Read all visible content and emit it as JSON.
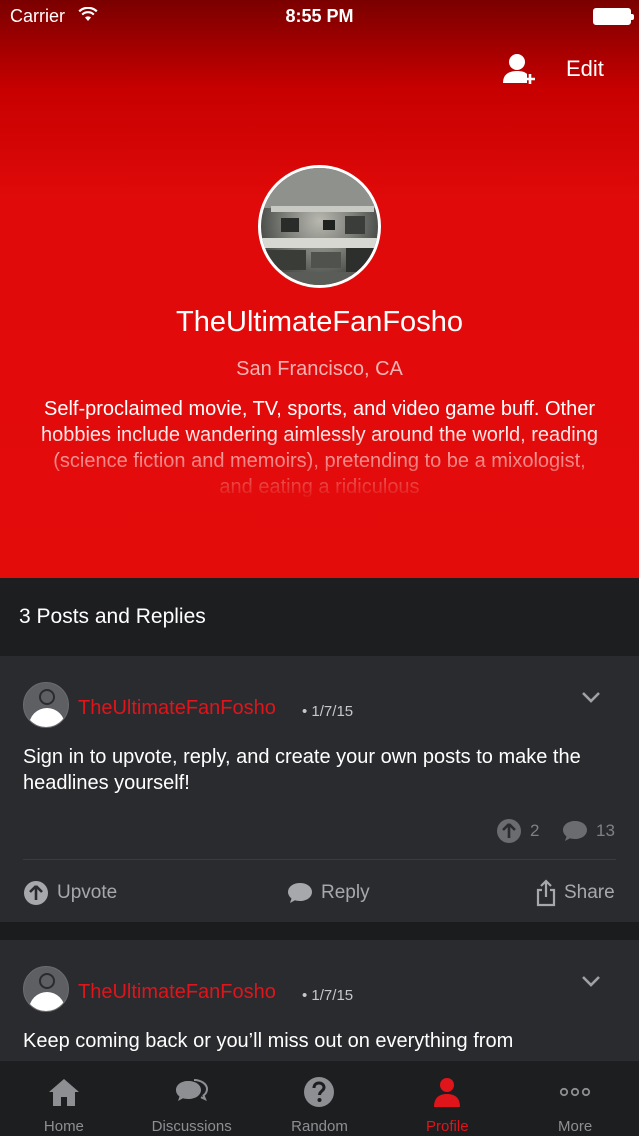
{
  "status_bar": {
    "carrier": "Carrier",
    "time": "8:55 PM"
  },
  "header": {
    "edit_label": "Edit",
    "username": "TheUltimateFanFosho",
    "location": "San Francisco, CA",
    "bio": "Self-proclaimed movie, TV, sports, and video game buff. Other hobbies include wandering aimlessly around the world, reading (science fiction and memoirs), pretending to be a mixologist, and eating a ridiculous"
  },
  "section": {
    "title": "3 Posts and Replies"
  },
  "posts": [
    {
      "author": "TheUltimateFanFosho",
      "date": "• 1/7/15",
      "text": "Sign in to upvote, reply, and create your own posts to make the headlines yourself!",
      "upvotes": "2",
      "comments": "13",
      "upvote_label": "Upvote",
      "reply_label": "Reply",
      "share_label": "Share"
    },
    {
      "author": "TheUltimateFanFosho",
      "date": "• 1/7/15",
      "text": "Keep coming back or you’ll miss out on everything from"
    }
  ],
  "tabs": [
    {
      "label": "Home",
      "icon": "home-icon"
    },
    {
      "label": "Discussions",
      "icon": "discussions-icon"
    },
    {
      "label": "Random",
      "icon": "question-icon"
    },
    {
      "label": "Profile",
      "icon": "profile-icon",
      "active": true
    },
    {
      "label": "More",
      "icon": "more-icon"
    }
  ],
  "colors": {
    "accent": "#e0141b",
    "header_red": "#e40b0b",
    "background": "#1b1c1e",
    "card": "#2a2b2e"
  }
}
